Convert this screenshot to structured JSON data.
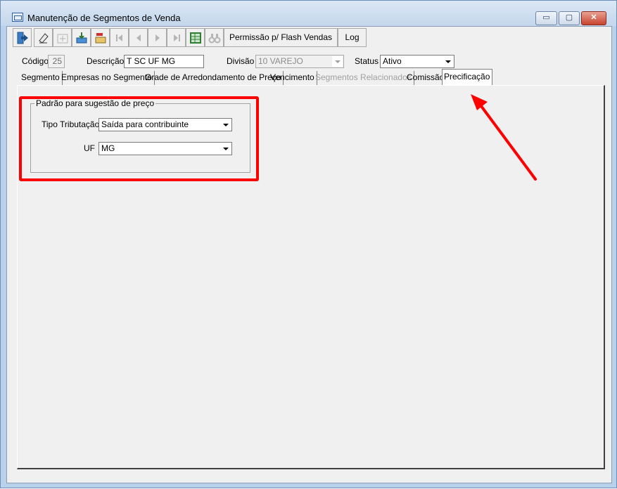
{
  "window": {
    "title": "Manutenção de Segmentos de Venda",
    "controls": {
      "minimize": "▭",
      "maximize": "▢",
      "close": "✕"
    }
  },
  "toolbar": {
    "permission_label": "Permissão p/ Flash Vendas",
    "log_label": "Log"
  },
  "form": {
    "code_label": "Código",
    "code_value": "25",
    "description_label": "Descrição",
    "description_value": "T  SC UF MG",
    "division_label": "Divisão",
    "division_value": "10 VAREJO",
    "status_label": "Status",
    "status_value": "Ativo"
  },
  "tabs": [
    {
      "label": "Segmento",
      "enabled": true
    },
    {
      "label": "Empresas no Segmento",
      "enabled": true
    },
    {
      "label": "Grade de Arredondamento de Preço",
      "enabled": true
    },
    {
      "label": "Vencimento",
      "enabled": true
    },
    {
      "label": "Segmentos Relacionados",
      "enabled": false
    },
    {
      "label": "Comissão",
      "enabled": true
    },
    {
      "label": "Precificação",
      "enabled": true,
      "active": true
    }
  ],
  "pricing": {
    "group_title": "Padrão para sugestão de preço",
    "tax_type_label": "Tipo Tributação",
    "tax_type_value": "Saída para contribuinte",
    "uf_label": "UF",
    "uf_value": "MG"
  },
  "colors": {
    "highlight": "#ff0000",
    "accent_green": "#2e7d32"
  }
}
